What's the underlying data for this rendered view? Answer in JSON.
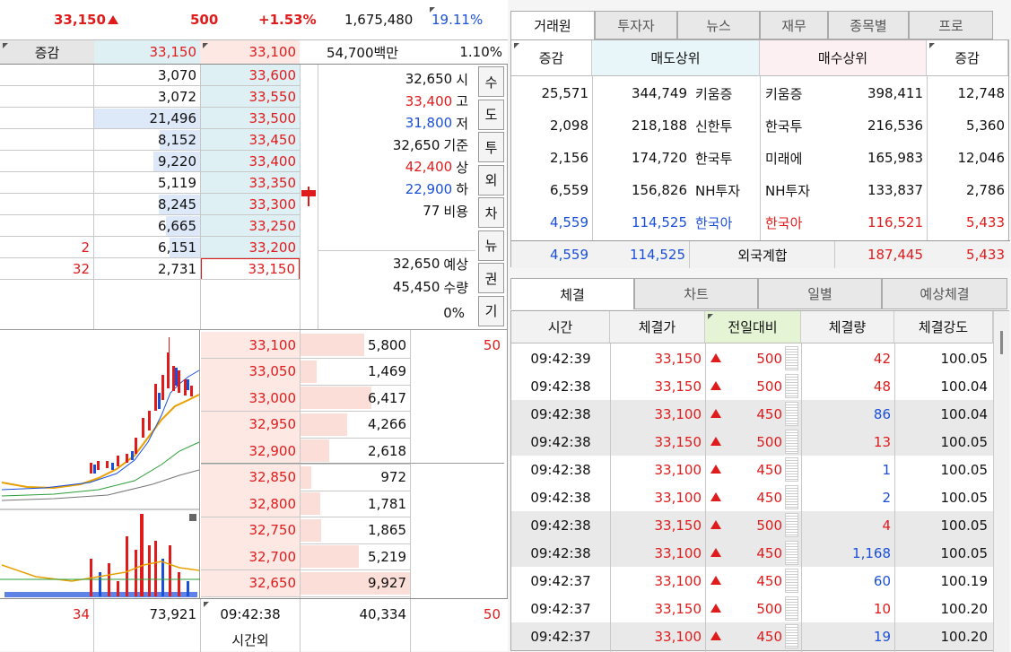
{
  "summary": {
    "price": "33,150",
    "change": "500",
    "rate": "+1.53%",
    "volume": "1,675,480",
    "ratio": "19.11%"
  },
  "summary2": {
    "label": "증감",
    "ask_total": "33,150",
    "bid_price": "33,100",
    "amount": "54,700백만",
    "pct": "1.10%"
  },
  "asks": [
    {
      "v2": "",
      "qty": "3,070",
      "price": "33,600",
      "bar": 0
    },
    {
      "v2": "",
      "qty": "3,072",
      "price": "33,550",
      "bar": 0
    },
    {
      "v2": "",
      "qty": "21,496",
      "price": "33,500",
      "bar": 1.0
    },
    {
      "v2": "",
      "qty": "8,152",
      "price": "33,450",
      "bar": 0.38
    },
    {
      "v2": "",
      "qty": "9,220",
      "price": "33,400",
      "bar": 0.44
    },
    {
      "v2": "",
      "qty": "5,119",
      "price": "33,350",
      "bar": 0
    },
    {
      "v2": "",
      "qty": "8,245",
      "price": "33,300",
      "bar": 0.39
    },
    {
      "v2": "",
      "qty": "6,665",
      "price": "33,250",
      "bar": 0.32
    },
    {
      "v2": "2",
      "qty": "6,151",
      "price": "33,200",
      "bar": 0.29
    },
    {
      "v2": "32",
      "qty": "2,731",
      "price": "33,150",
      "bar": 0
    }
  ],
  "info": [
    {
      "val": "32,650",
      "lab": "시",
      "cls": ""
    },
    {
      "val": "33,400",
      "lab": "고",
      "cls": "red"
    },
    {
      "val": "31,800",
      "lab": "저",
      "cls": "blue"
    },
    {
      "val": "32,650",
      "lab": "기준",
      "cls": ""
    },
    {
      "val": "42,400",
      "lab": "상",
      "cls": "red"
    },
    {
      "val": "22,900",
      "lab": "하",
      "cls": "blue"
    },
    {
      "val": "77",
      "lab": "비용",
      "cls": ""
    },
    {
      "val": "32,650",
      "lab": "예상",
      "cls": ""
    },
    {
      "val": "45,450",
      "lab": "수량",
      "cls": ""
    },
    {
      "val": "0%",
      "lab": "",
      "cls": ""
    }
  ],
  "side_tabs": [
    "수",
    "도",
    "투",
    "외",
    "차",
    "뉴",
    "권",
    "기"
  ],
  "bids": [
    {
      "price": "33,100",
      "qty": "5,800",
      "bar": 0.58
    },
    {
      "price": "33,050",
      "qty": "1,469",
      "bar": 0.15
    },
    {
      "price": "33,000",
      "qty": "6,417",
      "bar": 0.65
    },
    {
      "price": "32,950",
      "qty": "4,266",
      "bar": 0.43
    },
    {
      "price": "32,900",
      "qty": "2,618",
      "bar": 0.26
    },
    {
      "price": "32,850",
      "qty": "972",
      "bar": 0.1
    },
    {
      "price": "32,800",
      "qty": "1,781",
      "bar": 0.18
    },
    {
      "price": "32,750",
      "qty": "1,865",
      "bar": 0.19
    },
    {
      "price": "32,700",
      "qty": "5,219",
      "bar": 0.53
    },
    {
      "price": "32,650",
      "qty": "9,927",
      "bar": 1.0
    }
  ],
  "bid_extra": "50",
  "footer": {
    "left": "34",
    "total_ask": "73,921",
    "time": "09:42:38",
    "total_bid": "40,334",
    "right": "50",
    "after_hours": "시간외"
  },
  "top_tabs": [
    "거래원",
    "투자자",
    "뉴스",
    "재무",
    "종목별",
    "프로"
  ],
  "broker_headers": [
    "증감",
    "매도상위",
    "매수상위",
    "증감"
  ],
  "brokers": [
    {
      "chg1": "25,571",
      "sell": "344,749",
      "sname": "키움증",
      "bname": "키움증",
      "buy": "398,411",
      "chg2": "12,748",
      "cls": ""
    },
    {
      "chg1": "2,098",
      "sell": "218,188",
      "sname": "신한투",
      "bname": "한국투",
      "buy": "216,536",
      "chg2": "5,360",
      "cls": ""
    },
    {
      "chg1": "2,156",
      "sell": "174,720",
      "sname": "한국투",
      "bname": "미래에",
      "buy": "165,983",
      "chg2": "12,046",
      "cls": ""
    },
    {
      "chg1": "6,559",
      "sell": "156,826",
      "sname": "NH투자",
      "bname": "NH투자",
      "buy": "133,837",
      "chg2": "2,786",
      "cls": ""
    },
    {
      "chg1": "4,559",
      "sell": "114,525",
      "sname": "한국아",
      "bname": "한국아",
      "buy": "116,521",
      "chg2": "5,433",
      "cls": "foreign"
    }
  ],
  "foreign_total": {
    "chg1": "4,559",
    "sell": "114,525",
    "label": "외국계합",
    "buy": "187,445",
    "chg2": "5,433"
  },
  "bottom_tabs": [
    "체결",
    "차트",
    "일별",
    "예상체결"
  ],
  "tick_headers": [
    "시간",
    "체결가",
    "전일대비",
    "체결량",
    "체결강도"
  ],
  "ticks": [
    {
      "time": "09:42:39",
      "price": "33,150",
      "diff": "500",
      "qty": "42",
      "str": "100.05",
      "qcls": "red",
      "shade": false
    },
    {
      "time": "09:42:38",
      "price": "33,150",
      "diff": "500",
      "qty": "48",
      "str": "100.04",
      "qcls": "red",
      "shade": false
    },
    {
      "time": "09:42:38",
      "price": "33,100",
      "diff": "450",
      "qty": "86",
      "str": "100.04",
      "qcls": "blue",
      "shade": true
    },
    {
      "time": "09:42:38",
      "price": "33,150",
      "diff": "500",
      "qty": "13",
      "str": "100.05",
      "qcls": "red",
      "shade": true
    },
    {
      "time": "09:42:38",
      "price": "33,100",
      "diff": "450",
      "qty": "1",
      "str": "100.05",
      "qcls": "blue",
      "shade": false
    },
    {
      "time": "09:42:38",
      "price": "33,100",
      "diff": "450",
      "qty": "2",
      "str": "100.05",
      "qcls": "blue",
      "shade": false
    },
    {
      "time": "09:42:38",
      "price": "33,150",
      "diff": "500",
      "qty": "4",
      "str": "100.05",
      "qcls": "red",
      "shade": true
    },
    {
      "time": "09:42:38",
      "price": "33,100",
      "diff": "450",
      "qty": "1,168",
      "str": "100.05",
      "qcls": "blue",
      "shade": true
    },
    {
      "time": "09:42:37",
      "price": "33,100",
      "diff": "450",
      "qty": "60",
      "str": "100.19",
      "qcls": "blue",
      "shade": false
    },
    {
      "time": "09:42:37",
      "price": "33,150",
      "diff": "500",
      "qty": "10",
      "str": "100.20",
      "qcls": "red",
      "shade": false
    },
    {
      "time": "09:42:37",
      "price": "33,100",
      "diff": "450",
      "qty": "19",
      "str": "100.20",
      "qcls": "blue",
      "shade": true
    }
  ],
  "colors": {
    "up": "#e01b1b",
    "down": "#1a4fd8",
    "ask_bg": "#dff0f5",
    "bid_bg": "#fde8e4",
    "ask_bar": "#dde8f8",
    "bid_bar": "#fbded7"
  }
}
